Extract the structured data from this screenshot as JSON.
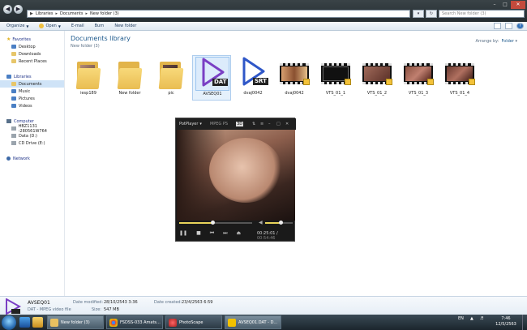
{
  "address_bar": {
    "crumbs": [
      "Libraries",
      "Documents",
      "New folder (3)"
    ],
    "search_placeholder": "Search New folder (3)"
  },
  "toolbar": {
    "organize": "Organize",
    "open": "Open",
    "email": "E-mail",
    "burn": "Burn",
    "new_folder": "New folder"
  },
  "nav": {
    "favorites": "Favorites",
    "fav_items": [
      "Desktop",
      "Downloads",
      "Recent Places"
    ],
    "libraries": "Libraries",
    "lib_items": [
      "Documents",
      "Music",
      "Pictures",
      "Videos"
    ],
    "computer": "Computer",
    "comp_items": [
      "HBZ1131 -280561W764",
      "Data (D:)",
      "CD Drive (E:)"
    ],
    "network": "Network"
  },
  "library": {
    "title": "Documents library",
    "subtitle": "New folder (3)",
    "arrange_label": "Arrange by:",
    "arrange_value": "Folder"
  },
  "files": [
    {
      "name": "iesp189",
      "kind": "folder"
    },
    {
      "name": "New folder",
      "kind": "folder"
    },
    {
      "name": "pic",
      "kind": "folder"
    },
    {
      "name": "AVSEQ01",
      "kind": "dat",
      "ext": "DAT"
    },
    {
      "name": "dvaj0042",
      "kind": "srt",
      "ext": "SRT"
    },
    {
      "name": "dvaj0042",
      "kind": "video"
    },
    {
      "name": "VTS_01_1",
      "kind": "video"
    },
    {
      "name": "VTS_01_2",
      "kind": "video"
    },
    {
      "name": "VTS_01_3",
      "kind": "video"
    },
    {
      "name": "VTS_01_4",
      "kind": "video"
    }
  ],
  "player": {
    "app": "PotPlayer",
    "format": "MPEG PS",
    "badge": "3D",
    "time_current": "00:25:01",
    "time_total": "00:54:46",
    "progress": 0.46,
    "volume": 0.55
  },
  "details": {
    "name": "AVSEQ01",
    "type": "DAT - MPEG video file",
    "modified_label": "Date modified:",
    "modified": "28/10/2543 3:36",
    "size_label": "Size:",
    "size": "547 MB",
    "created_label": "Date created:",
    "created": "23/4/2563 6:59"
  },
  "taskbar": {
    "tasks": [
      "New folder (3)",
      "FSDSS-033 Amats...",
      "PhotoScape",
      "AVSEQ01.DAT - D..."
    ],
    "lang": "EN",
    "time": "7:46",
    "date": "12/5/2563"
  }
}
